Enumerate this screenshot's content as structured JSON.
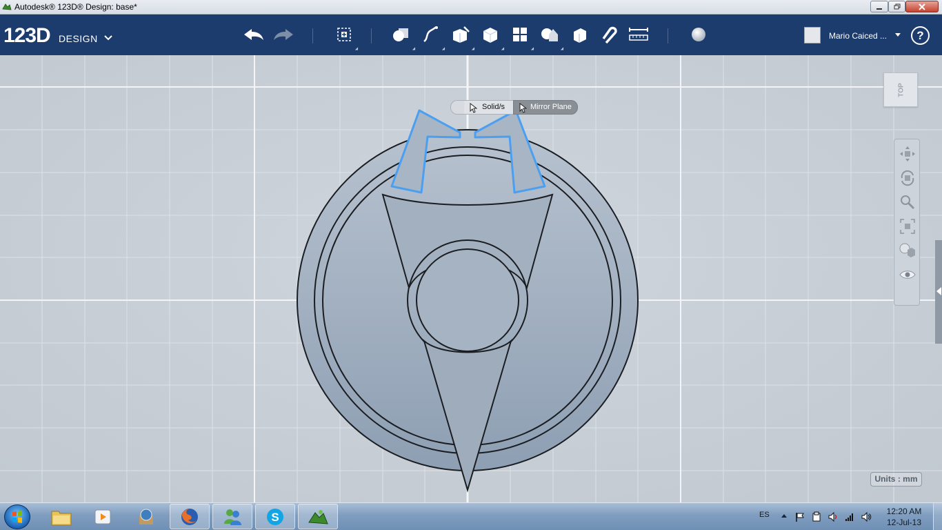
{
  "window": {
    "title": "Autodesk® 123D® Design: base*"
  },
  "toolbar": {
    "logo_main": "123D",
    "logo_sub": "DESIGN",
    "tools": [
      "undo",
      "redo",
      "transform",
      "primitives",
      "sketch",
      "construct",
      "modify",
      "pattern",
      "grouping",
      "combine",
      "snap",
      "measure",
      "material"
    ]
  },
  "user": {
    "name": "Mario Caiced ..."
  },
  "help": {
    "label": "?"
  },
  "viewcube": {
    "face": "TOP"
  },
  "context_menu": {
    "option_solids": "Solid/s",
    "option_mirror_plane": "Mirror Plane"
  },
  "units": {
    "label": "Units : mm"
  },
  "taskbar": {
    "apps": [
      "explorer",
      "media-player",
      "gallery",
      "firefox",
      "messenger",
      "skype",
      "123d-design"
    ],
    "language": "ES",
    "time": "12:20 AM",
    "date": "12-Jul-13"
  },
  "colors": {
    "toolbar_bg": "#1d3c6e",
    "viewport_bg": "#c5ccd4",
    "selection": "#4a9ff0",
    "model_fill": "#9aa9ba"
  }
}
